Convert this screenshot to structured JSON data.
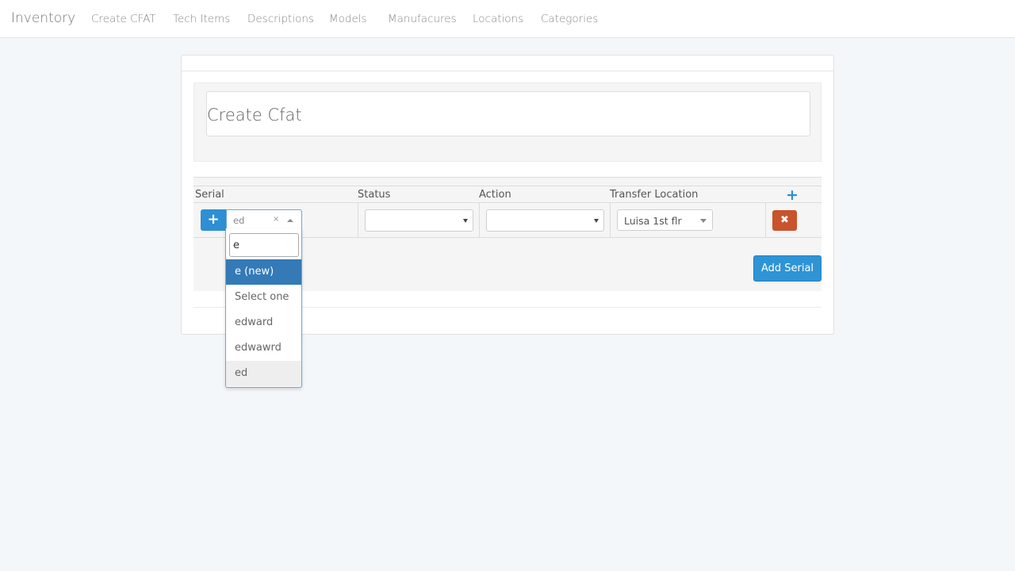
{
  "navbar": {
    "brand": "Inventory",
    "links": [
      "Create CFAT",
      "Tech Items",
      "Descriptions",
      "Models",
      "Manufacures",
      "Locations",
      "Categories"
    ]
  },
  "page": {
    "title": "Create Cfat"
  },
  "table": {
    "headers": {
      "serial": "Serial",
      "status": "Status",
      "action": "Action",
      "transfer_location": "Transfer Location"
    },
    "row": {
      "serial_value": "ed",
      "status_value": "",
      "action_value": "",
      "transfer_location_value": "Luisa 1st flr"
    }
  },
  "icons": {
    "add_row": "plus-icon",
    "add_column": "plus-icon",
    "remove_row": "times-icon",
    "clear": "times-icon"
  },
  "dropdown": {
    "search_value": "e",
    "options": [
      "e (new)",
      "Select one",
      "edward",
      "edwawrd",
      "ed"
    ],
    "highlighted_index": 0,
    "selected_index": 4
  },
  "buttons": {
    "add_serial": "Add Serial"
  },
  "colors": {
    "primary": "#2e8fd3",
    "danger": "#c9532b",
    "highlight": "#337ab7",
    "background": "#f4f7fa"
  }
}
